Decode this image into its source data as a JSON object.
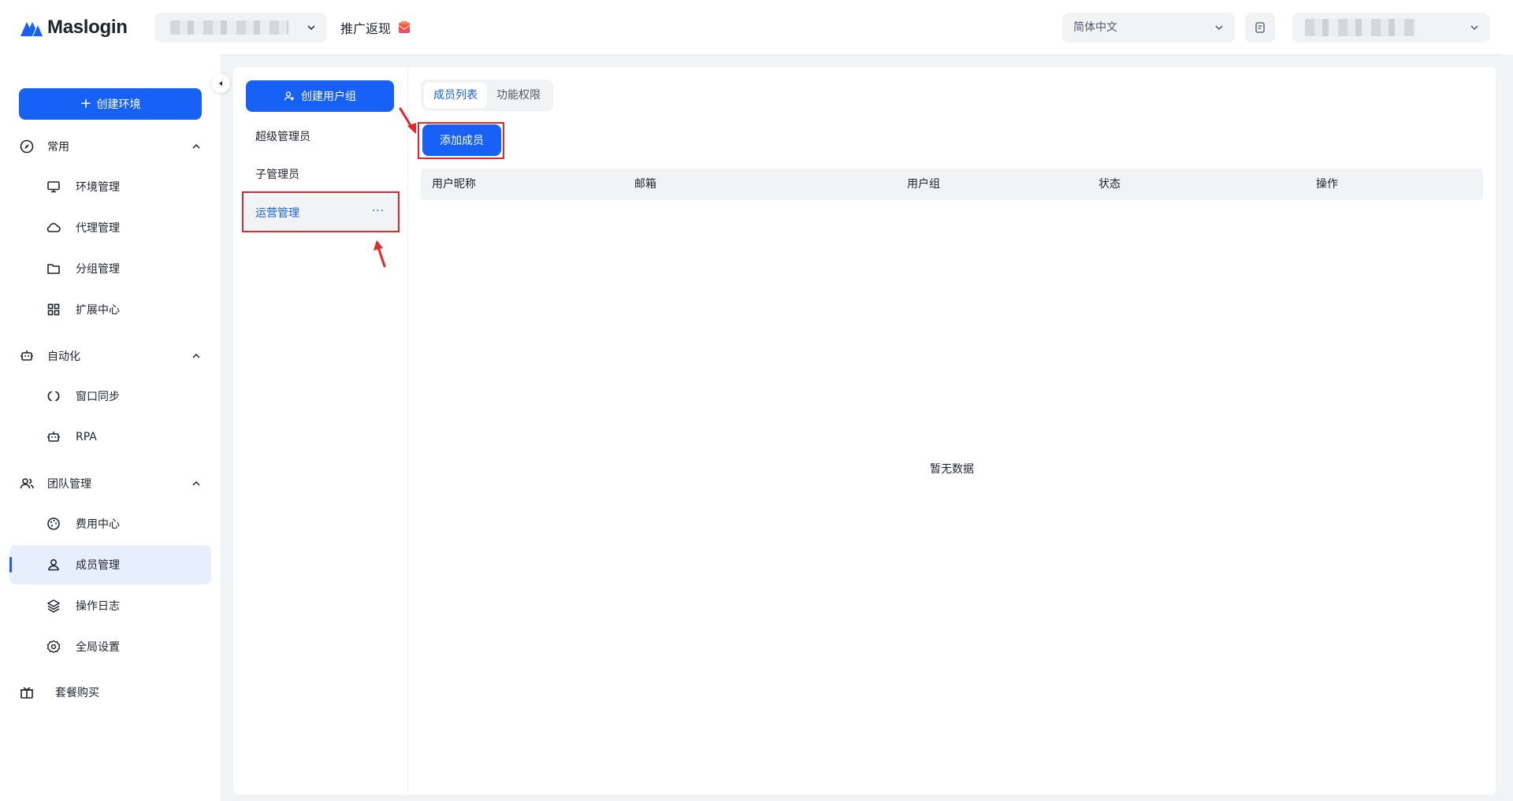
{
  "brand": {
    "name": "Maslogin"
  },
  "header": {
    "promo_label": "推广返现",
    "language": "简体中文"
  },
  "sidebar": {
    "create_button": "创建环境",
    "groups": [
      {
        "label": "常用",
        "items": [
          "环境管理",
          "代理管理",
          "分组管理",
          "扩展中心"
        ]
      },
      {
        "label": "自动化",
        "items": [
          "窗口同步",
          "RPA"
        ]
      },
      {
        "label": "团队管理",
        "items": [
          "费用中心",
          "成员管理",
          "操作日志",
          "全局设置"
        ]
      }
    ],
    "active_item": "成员管理",
    "bottom_item": "套餐购买"
  },
  "user_groups": {
    "create_button": "创建用户组",
    "items": [
      "超级管理员",
      "子管理员",
      "运营管理"
    ],
    "active": "运营管理",
    "more_label": "···"
  },
  "content": {
    "tabs": [
      "成员列表",
      "功能权限"
    ],
    "active_tab": "成员列表",
    "add_button": "添加成员",
    "columns": [
      "用户昵称",
      "邮箱",
      "用户组",
      "状态",
      "操作"
    ],
    "empty_text": "暂无数据"
  },
  "colors": {
    "primary": "#1761f6",
    "highlight": "#e5262b",
    "active_bg": "#e7efff"
  }
}
